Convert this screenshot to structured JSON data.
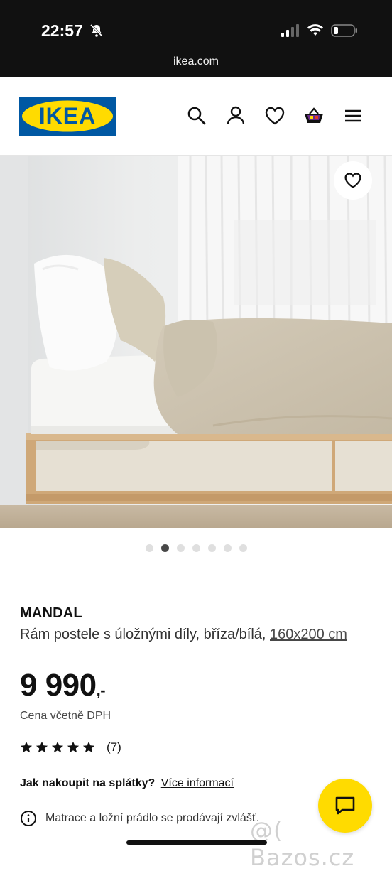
{
  "status_bar": {
    "time": "22:57",
    "url": "ikea.com"
  },
  "header": {
    "logo_text": "IKEA",
    "icons": [
      "search-icon",
      "account-icon",
      "heart-icon",
      "cart-icon",
      "menu-icon"
    ]
  },
  "gallery": {
    "image_count": 7,
    "active_index": 1
  },
  "product": {
    "name": "MANDAL",
    "description": "Rám postele s úložnými díly, bříza/bílá, ",
    "size": "160x200 cm",
    "price": "9 990",
    "price_suffix": ",-",
    "vat_note": "Cena včetně DPH",
    "rating_stars": 5,
    "rating_count": "(7)"
  },
  "installments": {
    "question": "Jak nakoupit na splátky?",
    "link": "Více informací"
  },
  "notice": {
    "text": "Matrace a ložní prádlo se prodávají zvlášť."
  },
  "watermark": "@( Bazos.cz",
  "colors": {
    "ikea_blue": "#0058a3",
    "ikea_yellow": "#ffdb00",
    "status_bar": "#111111"
  }
}
